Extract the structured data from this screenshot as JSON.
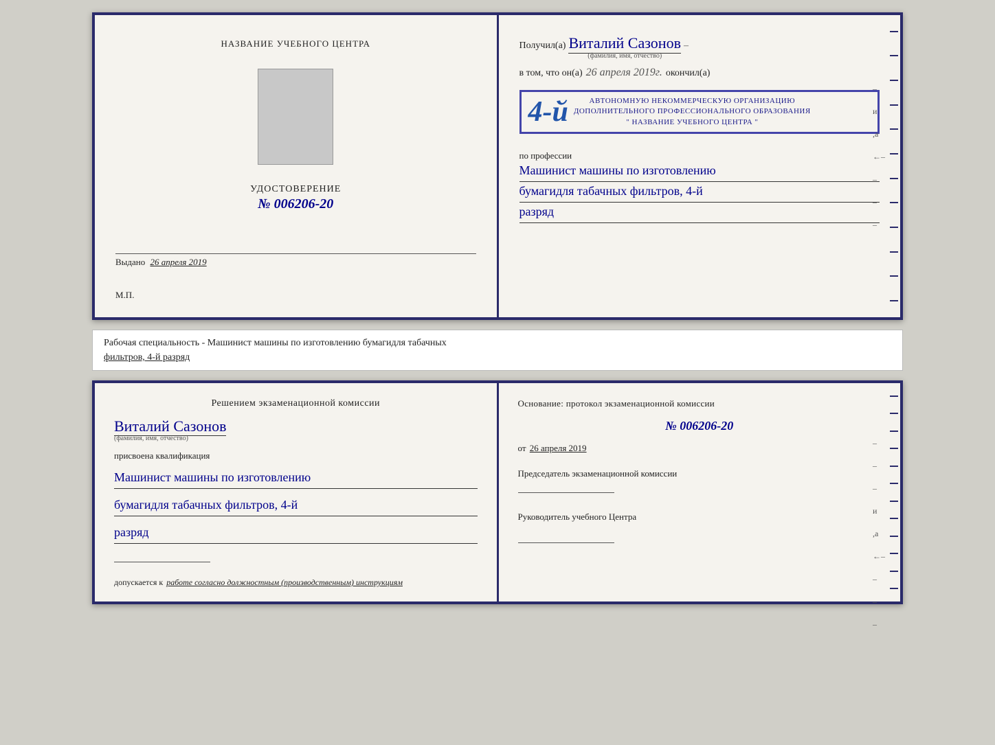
{
  "top_cert": {
    "left": {
      "school_name_label": "НАЗВАНИЕ УЧЕБНОГО ЦЕНТРА",
      "cert_title": "УДОСТОВЕРЕНИЕ",
      "cert_number": "№ 006206-20",
      "issued_label": "Выдано",
      "issued_date": "26 апреля 2019",
      "mp_label": "М.П."
    },
    "right": {
      "received_prefix": "Получил(а)",
      "recipient_name": "Виталий Сазонов",
      "name_subtitle": "(фамилия, имя, отчество)",
      "dash": "–",
      "in_that_prefix": "в том, что он(а)",
      "in_that_date": "26 апреля 2019г.",
      "finished_label": "окончил(а)",
      "stamp_number": "4-й",
      "stamp_line1": "АВТОНОМНУЮ НЕКОММЕРЧЕСКУЮ ОРГАНИЗАЦИЮ",
      "stamp_line2": "ДОПОЛНИТЕЛЬНОГО ПРОФЕССИОНАЛЬНОГО ОБРАЗОВАНИЯ",
      "stamp_line3": "\" НАЗВАНИЕ УЧЕБНОГО ЦЕНТРА \"",
      "and_label": "и",
      "comma_a": ",а",
      "by_profession": "по профессии",
      "profession_line1": "Машинист машины по изготовлению",
      "profession_line2": "бумагидля табачных фильтров, 4-й",
      "profession_line3": "разряд"
    }
  },
  "description": {
    "text": "Рабочая специальность - Машинист машины по изготовлению бумагидля табачных",
    "underline_text": "фильтров, 4-й разряд"
  },
  "bottom_cert": {
    "left": {
      "decision_text": "Решением экзаменационной комиссии",
      "name": "Виталий Сазонов",
      "name_subtitle": "(фамилия, имя, отчество)",
      "qualification_label": "присвоена квалификация",
      "qualification_line1": "Машинист машины по изготовлению",
      "qualification_line2": "бумагидля табачных фильтров, 4-й",
      "qualification_line3": "разряд",
      "allowed_prefix": "допускается к",
      "allowed_text": "работе согласно должностным (производственным) инструкциям"
    },
    "right": {
      "basis_label": "Основание: протокол экзаменационной комиссии",
      "protocol_number": "№ 006206-20",
      "from_prefix": "от",
      "from_date": "26 апреля 2019",
      "chairman_label": "Председатель экзаменационной комиссии",
      "head_label": "Руководитель учебного Центра",
      "dash1": "–",
      "dash2": "–",
      "and_label": "и",
      "comma_a": ",а"
    }
  },
  "spine": {
    "line_count": 12
  }
}
